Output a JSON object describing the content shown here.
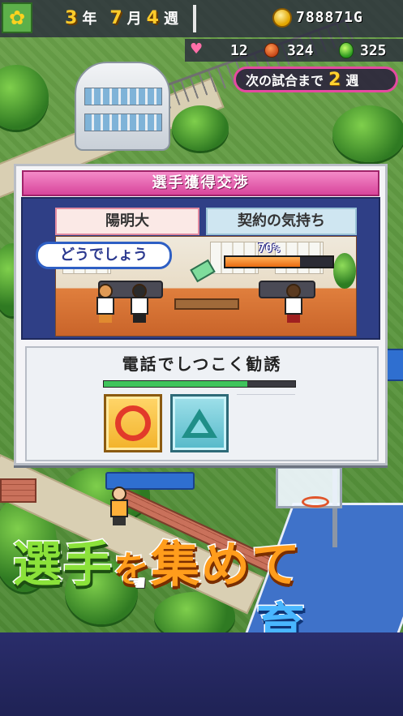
{
  "hud": {
    "year": "3",
    "year_unit": "年",
    "month": "7",
    "month_unit": "月",
    "week": "4",
    "week_unit": "週",
    "gold": "788871",
    "gold_unit": "G"
  },
  "stats": {
    "hearts": "12",
    "balls": "324",
    "items": "325"
  },
  "next_match": {
    "label": "次の試合まで",
    "weeks": "2",
    "unit": "週"
  },
  "panel": {
    "title": "選手獲得交渉",
    "college": "陽明大",
    "feeling_label": "契約の気持ち",
    "speech": "どうでしょう",
    "feeling_text": "70%",
    "feeling_fraction": 0.7,
    "action_label": "電話でしつこく勧誘",
    "action_progress": 0.75
  },
  "slogan": {
    "word1_a": "選手",
    "word1_b": "を",
    "word1_c": "集めて",
    "word2": "育成",
    "word2_end": "！"
  },
  "icons": {
    "season": "sunflower-icon",
    "money": "gold-coin-icon",
    "heart": "heart-icon",
    "ball": "basketball-icon",
    "item": "green-drop-icon",
    "confirm": "circle-button-icon",
    "maybe": "triangle-button-icon",
    "pointer": "hand-pointer-icon"
  },
  "colors": {
    "title_pink": "#e85aaa",
    "panel_navy": "#2f3f86",
    "feel_orange": "#ea6b12",
    "progress_green": "#3fc45b",
    "slogan_green": "#8be23a",
    "slogan_orange": "#ff9d1c",
    "slogan_blue": "#49b6ff"
  }
}
